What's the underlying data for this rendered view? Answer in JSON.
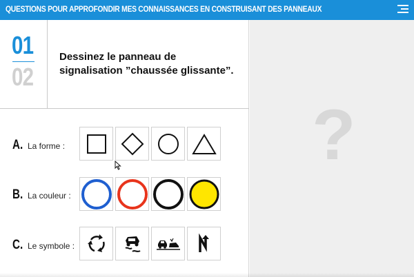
{
  "header": {
    "title": "QUESTIONS POUR APPROFONDIR MES CONNAISSANCES EN CONSTRUISANT DES PANNEAUX",
    "menu_icon": "hamburger-menu-icon"
  },
  "question": {
    "current": "01",
    "total": "02",
    "text": "Dessinez le panneau de signalisation ”chaussée glissante”."
  },
  "answer_panel": {
    "placeholder": "?"
  },
  "rows": {
    "shape": {
      "letter": "A.",
      "label": "La forme :",
      "options": [
        "square-shape-icon",
        "diamond-shape-icon",
        "circle-shape-icon",
        "triangle-shape-icon"
      ]
    },
    "color": {
      "letter": "B.",
      "label": "La couleur :",
      "options": [
        "blue",
        "red",
        "black",
        "yellow"
      ]
    },
    "symbol": {
      "letter": "C.",
      "label": "Le symbole :",
      "options": [
        "roundabout-symbol-icon",
        "slippery-road-symbol-icon",
        "cars-queue-symbol-icon",
        "double-bend-symbol-icon"
      ]
    }
  },
  "colors": {
    "accent": "#1a8fd9",
    "blue": "#1f5fd0",
    "red": "#e8341c",
    "black": "#111111",
    "yellow": "#ffe600"
  }
}
